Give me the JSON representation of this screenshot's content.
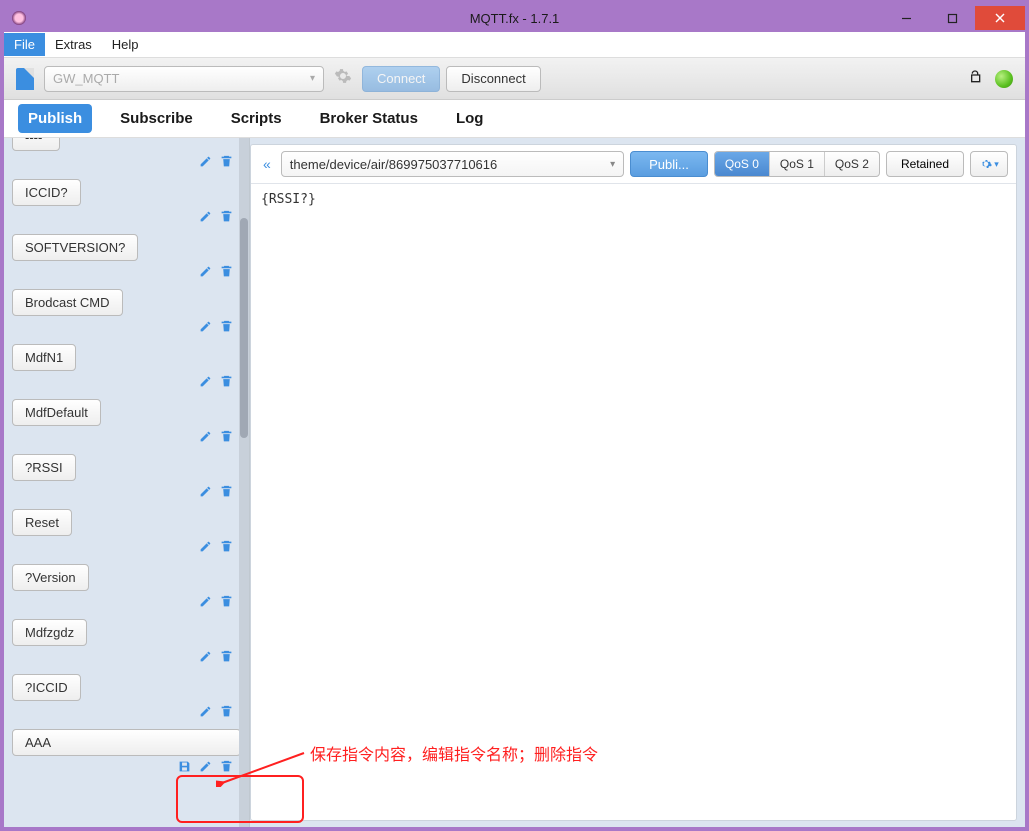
{
  "window": {
    "title": "MQTT.fx - 1.7.1"
  },
  "menu": {
    "file": "File",
    "extras": "Extras",
    "help": "Help"
  },
  "conn": {
    "profile_placeholder": "GW_MQTT",
    "connect": "Connect",
    "disconnect": "Disconnect"
  },
  "tabs": {
    "publish": "Publish",
    "subscribe": "Subscribe",
    "scripts": "Scripts",
    "broker_status": "Broker Status",
    "log": "Log"
  },
  "sidebar": {
    "items": [
      {
        "label": "----"
      },
      {
        "label": "ICCID?"
      },
      {
        "label": "SOFTVERSION?"
      },
      {
        "label": "Brodcast CMD"
      },
      {
        "label": "MdfN1"
      },
      {
        "label": "MdfDefault"
      },
      {
        "label": "?RSSI"
      },
      {
        "label": "Reset"
      },
      {
        "label": "?Version"
      },
      {
        "label": "Mdfzgdz"
      },
      {
        "label": "?ICCID"
      },
      {
        "label": "AAA"
      }
    ]
  },
  "publish": {
    "topic": "theme/device/air/869975037710616",
    "btn": "Publi...",
    "qos0": "QoS 0",
    "qos1": "QoS 1",
    "qos2": "QoS 2",
    "retained": "Retained",
    "payload": "{RSSI?}"
  },
  "annotation": "保存指令内容，编辑指令名称；删除指令",
  "icons": {
    "gear": "gear-icon",
    "lock": "unlock-icon",
    "edit": "edit-icon",
    "trash": "trash-icon",
    "save": "save-icon",
    "collapse": "collapse-left-icon",
    "caret": "caret-down-icon",
    "minimize": "minimize-icon",
    "maximize": "maximize-icon",
    "close": "close-icon",
    "settings_mini": "settings-mini-icon"
  }
}
